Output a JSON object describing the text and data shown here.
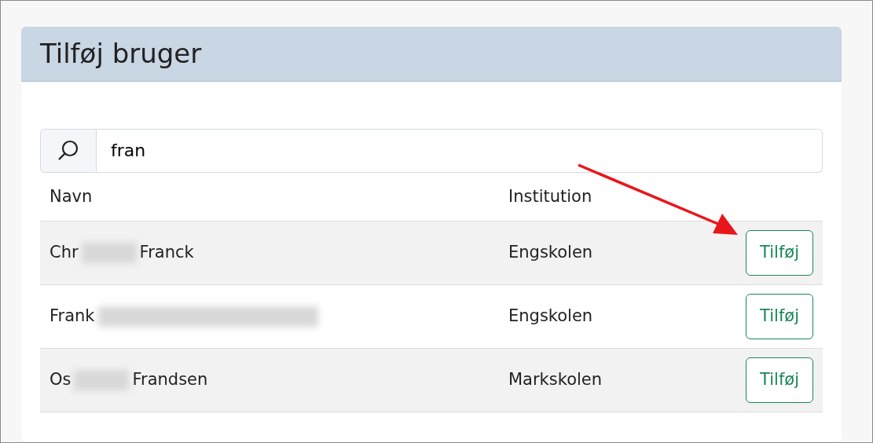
{
  "card": {
    "title": "Tilføj bruger"
  },
  "search": {
    "value": "fran"
  },
  "table": {
    "columns": [
      "Navn",
      "Institution"
    ],
    "rows": [
      {
        "name_parts": [
          {
            "kind": "text",
            "text": "Chr"
          },
          {
            "kind": "redacted"
          },
          {
            "kind": "text",
            "text": "Franck"
          }
        ],
        "institution": "Engskolen",
        "button": "Tilføj",
        "striped": true
      },
      {
        "name_parts": [
          {
            "kind": "text",
            "text": "Frank"
          },
          {
            "kind": "redacted",
            "wide": true
          }
        ],
        "institution": "Engskolen",
        "button": "Tilføj",
        "striped": false
      },
      {
        "name_parts": [
          {
            "kind": "text",
            "text": "Os"
          },
          {
            "kind": "redacted",
            "wide": false
          },
          {
            "kind": "text",
            "text": "Frandsen"
          }
        ],
        "institution": "Markskolen",
        "button": "Tilføj",
        "striped": true
      }
    ]
  },
  "annotations": [
    {
      "kind": "arrow",
      "color": "#e8161b"
    }
  ]
}
